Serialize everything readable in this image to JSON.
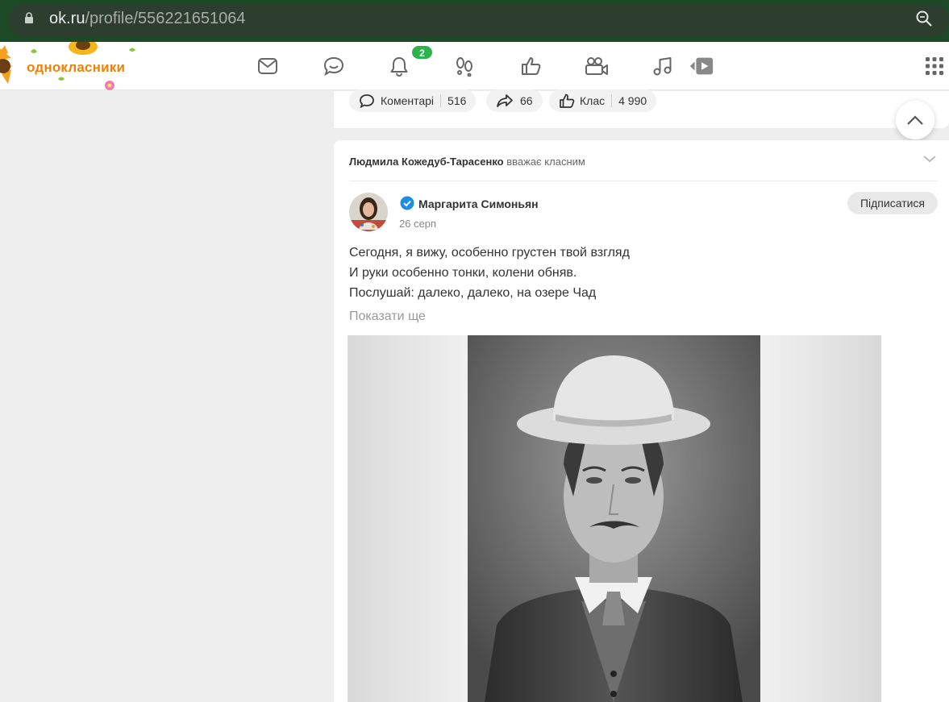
{
  "browser": {
    "url_host": "ok.ru",
    "url_path": "/profile/556221651064"
  },
  "header": {
    "logo_text": "однокласники",
    "nav": [
      {
        "name": "messages-icon"
      },
      {
        "name": "discussions-icon"
      },
      {
        "name": "notifications-icon",
        "badge": "2"
      },
      {
        "name": "guests-icon"
      },
      {
        "name": "events-icon"
      },
      {
        "name": "video-icon"
      },
      {
        "name": "music-icon"
      },
      {
        "name": "games-icon"
      }
    ],
    "apps_icon": "grid-icon"
  },
  "prev_post": {
    "comments_label": "Коментарі",
    "comments_count": "516",
    "shares_count": "66",
    "like_label": "Клас",
    "like_count": "4 990"
  },
  "post": {
    "liker_name": "Людмила Кожедуб-Тарасенко",
    "liker_action": "вважає класним",
    "author": "Маргарита Симоньян",
    "date": "26 серп",
    "subscribe_label": "Підписатися",
    "lines": [
      "Сегодня, я вижу, особенно грустен твой взгляд",
      "И руки особенно тонки, колени обняв.",
      "Послушай: далеко, далеко, на озере Чад"
    ],
    "show_more": "Показати ще"
  },
  "colors": {
    "accent": "#ee8208",
    "badge": "#2cb34c",
    "browser_bar": "#1d4a26"
  }
}
